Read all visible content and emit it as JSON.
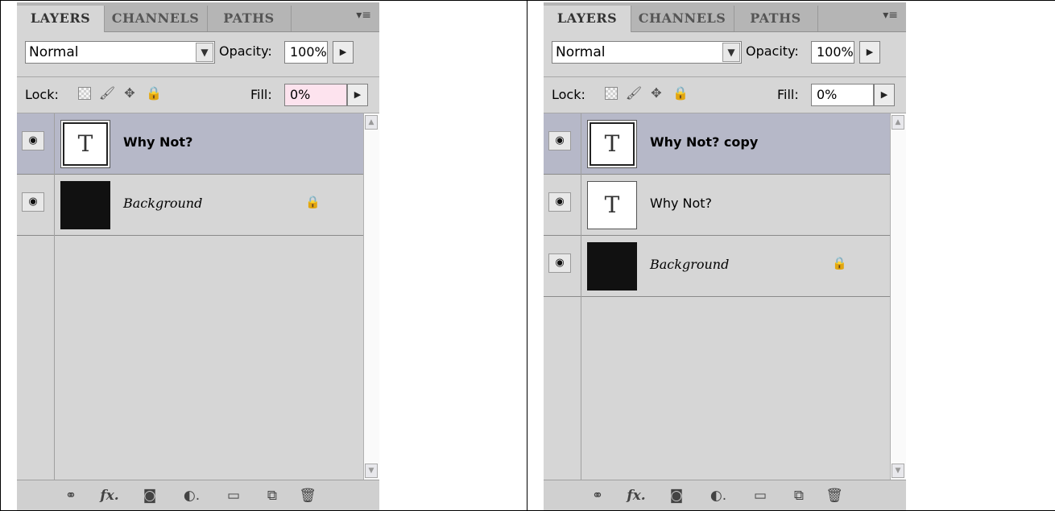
{
  "panels": [
    {
      "tabs": [
        "LAYERS",
        "CHANNELS",
        "PATHS"
      ],
      "blend_mode": "Normal",
      "opacity_label": "Opacity:",
      "opacity_value": "100%",
      "lock_label": "Lock:",
      "fill_label": "Fill:",
      "fill_value": "0%",
      "fill_highlight": "#fde3ee",
      "layers": [
        {
          "name": "Why Not?",
          "thumb": "T",
          "style": "bold",
          "selected": true
        },
        {
          "name": "Background",
          "thumb": "",
          "style": "italic",
          "selected": false,
          "locked": true
        }
      ]
    },
    {
      "tabs": [
        "LAYERS",
        "CHANNELS",
        "PATHS"
      ],
      "blend_mode": "Normal",
      "opacity_label": "Opacity:",
      "opacity_value": "100%",
      "lock_label": "Lock:",
      "fill_label": "Fill:",
      "fill_value": "0%",
      "fill_highlight": "#ffffff",
      "layers": [
        {
          "name": "Why Not? copy",
          "thumb": "T",
          "style": "bold",
          "selected": true
        },
        {
          "name": "Why Not?",
          "thumb": "T",
          "style": "normal",
          "selected": false
        },
        {
          "name": "Background",
          "thumb": "",
          "style": "italic",
          "selected": false,
          "locked": true
        }
      ]
    }
  ],
  "icons": {
    "panel_menu": "panel-menu-icon",
    "link": "link-layers-icon",
    "fx": "fx",
    "mask": "add-mask-icon",
    "adjustment": "adjustment-layer-icon",
    "group": "new-group-icon",
    "new_layer": "new-layer-icon",
    "trash": "delete-layer-icon"
  }
}
